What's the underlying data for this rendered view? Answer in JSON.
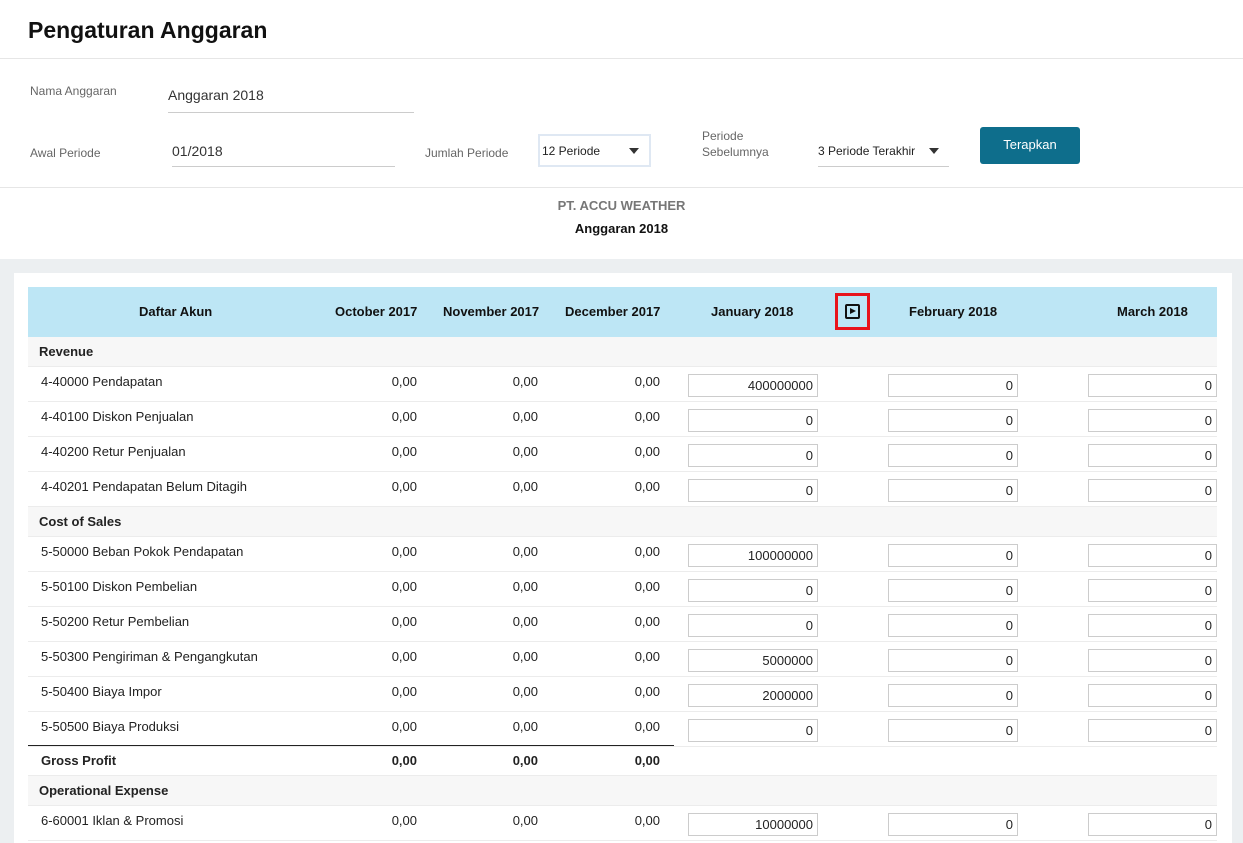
{
  "page": {
    "title": "Pengaturan Anggaran"
  },
  "form": {
    "budget_name_label": "Nama Anggaran",
    "budget_name_value": "Anggaran 2018",
    "start_period_label": "Awal Periode",
    "start_period_value": "01/2018",
    "period_count_label": "Jumlah Periode",
    "period_count_value": "12 Periode",
    "prev_period_label_1": "Periode",
    "prev_period_label_2": "Sebelumnya",
    "prev_period_value": "3 Periode Terakhir",
    "apply_button": "Terapkan"
  },
  "report": {
    "company": "PT. ACCU WEATHER",
    "budget": "Anggaran 2018"
  },
  "table": {
    "headers": {
      "account": "Daftar Akun",
      "prev1": "October 2017",
      "prev2": "November 2017",
      "prev3": "December 2017",
      "cur1": "January 2018",
      "cur2": "February 2018",
      "cur3": "March 2018"
    },
    "nav_icon": "next-period-icon",
    "sections": {
      "revenue": "Revenue",
      "cost_of_sales": "Cost of Sales",
      "operational_expense": "Operational Expense"
    },
    "rows": [
      {
        "account": "4-40000 Pendapatan",
        "p1": "0,00",
        "p2": "0,00",
        "p3": "0,00",
        "jan": "400000000",
        "feb": "0",
        "mar": "0"
      },
      {
        "account": "4-40100 Diskon Penjualan",
        "p1": "0,00",
        "p2": "0,00",
        "p3": "0,00",
        "jan": "0",
        "feb": "0",
        "mar": "0"
      },
      {
        "account": "4-40200 Retur Penjualan",
        "p1": "0,00",
        "p2": "0,00",
        "p3": "0,00",
        "jan": "0",
        "feb": "0",
        "mar": "0"
      },
      {
        "account": "4-40201 Pendapatan Belum Ditagih",
        "p1": "0,00",
        "p2": "0,00",
        "p3": "0,00",
        "jan": "0",
        "feb": "0",
        "mar": "0"
      },
      {
        "account": "5-50000 Beban Pokok Pendapatan",
        "p1": "0,00",
        "p2": "0,00",
        "p3": "0,00",
        "jan": "100000000",
        "feb": "0",
        "mar": "0"
      },
      {
        "account": "5-50100 Diskon Pembelian",
        "p1": "0,00",
        "p2": "0,00",
        "p3": "0,00",
        "jan": "0",
        "feb": "0",
        "mar": "0"
      },
      {
        "account": "5-50200 Retur Pembelian",
        "p1": "0,00",
        "p2": "0,00",
        "p3": "0,00",
        "jan": "0",
        "feb": "0",
        "mar": "0"
      },
      {
        "account": "5-50300 Pengiriman & Pengangkutan",
        "p1": "0,00",
        "p2": "0,00",
        "p3": "0,00",
        "jan": "5000000",
        "feb": "0",
        "mar": "0"
      },
      {
        "account": "5-50400 Biaya Impor",
        "p1": "0,00",
        "p2": "0,00",
        "p3": "0,00",
        "jan": "2000000",
        "feb": "0",
        "mar": "0"
      },
      {
        "account": "5-50500 Biaya Produksi",
        "p1": "0,00",
        "p2": "0,00",
        "p3": "0,00",
        "jan": "0",
        "feb": "0",
        "mar": "0"
      },
      {
        "account": "6-60001 Iklan & Promosi",
        "p1": "0,00",
        "p2": "0,00",
        "p3": "0,00",
        "jan": "10000000",
        "feb": "0",
        "mar": "0"
      }
    ],
    "gross_profit": {
      "label": "Gross Profit",
      "p1": "0,00",
      "p2": "0,00",
      "p3": "0,00"
    }
  }
}
